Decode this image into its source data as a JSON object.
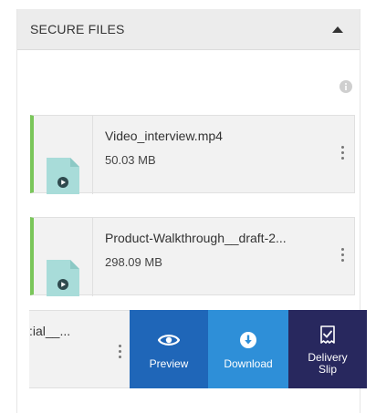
{
  "panel": {
    "title": "SECURE FILES"
  },
  "files": [
    {
      "name": "Video_interview.mp4",
      "size": "50.03 MB"
    },
    {
      "name": "Product-Walkthrough__draft-2...",
      "size": "298.09 MB"
    },
    {
      "name": ":ial__..."
    }
  ],
  "actions": {
    "preview": "Preview",
    "download": "Download",
    "delivery": "Delivery Slip"
  },
  "colors": {
    "accent_green": "#7ac65a",
    "preview_bg": "#1f66b8",
    "download_bg": "#2e8fd8",
    "delivery_bg": "#28285e",
    "thumb": "#a8dcd9"
  },
  "icons": {
    "collapse": "caret-up-icon",
    "info": "info-icon",
    "thumb": "video-file-icon",
    "more": "kebab-menu-icon",
    "preview": "eye-icon",
    "download": "download-circle-icon",
    "delivery": "receipt-check-icon"
  }
}
